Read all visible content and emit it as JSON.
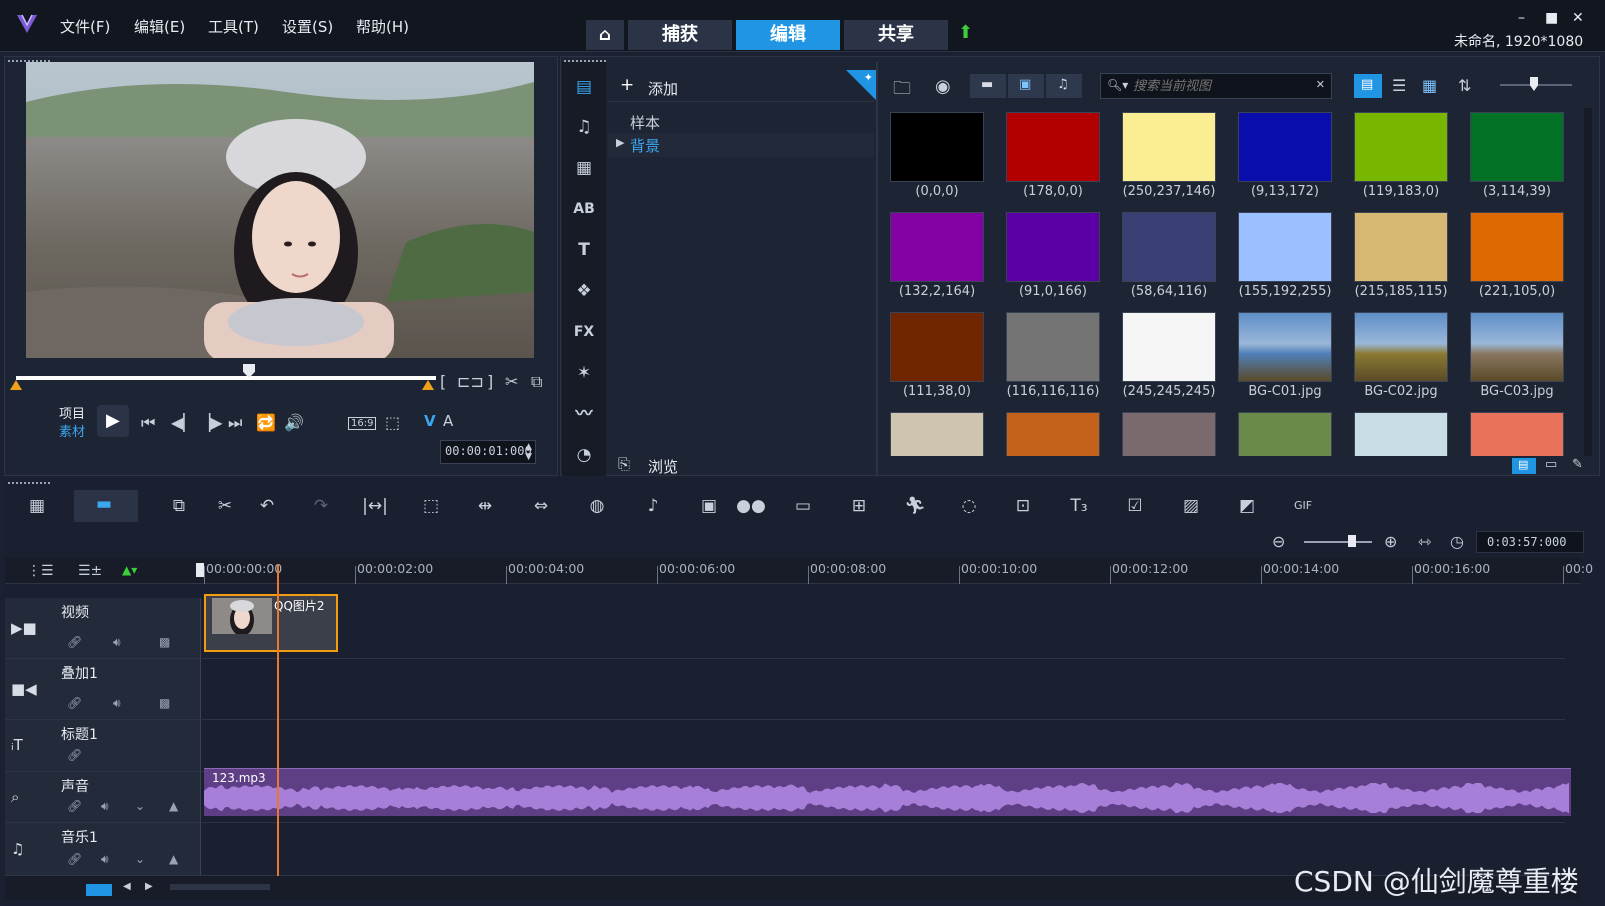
{
  "menu": [
    "文件(F)",
    "编辑(E)",
    "工具(T)",
    "设置(S)",
    "帮助(H)"
  ],
  "main_tabs": {
    "home_icon": "home-icon",
    "capture": "捕获",
    "edit": "编辑",
    "share": "共享"
  },
  "project_info": "未命名, 1920*1080",
  "window_controls": {
    "minimize": "–",
    "maximize": "■",
    "close": "✕"
  },
  "player": {
    "mode_project": "项目",
    "mode_clip": "素材",
    "timecode": "00:00:01:000",
    "aspect": "16:9",
    "v_label": "V",
    "a_label": "A"
  },
  "library": {
    "add_label": "添加",
    "tree": [
      "样本",
      "背景"
    ],
    "selected_tree_item": "背景",
    "browse_label": "浏览",
    "search_placeholder": "搜索当前视图",
    "side_icons": [
      "media-icon",
      "instant-project-icon",
      "transition-icon",
      "title-ab-icon",
      "text-icon",
      "graphic-icon",
      "fx-icon",
      "filter-icon",
      "path-icon",
      "speed-icon"
    ],
    "fx_label": "FX",
    "swatches": [
      {
        "label": "(0,0,0)",
        "color": "#000000"
      },
      {
        "label": "(178,0,0)",
        "color": "#b20000"
      },
      {
        "label": "(250,237,146)",
        "color": "#faed92"
      },
      {
        "label": "(9,13,172)",
        "color": "#090dac"
      },
      {
        "label": "(119,183,0)",
        "color": "#77b700"
      },
      {
        "label": "(3,114,39)",
        "color": "#037227"
      },
      {
        "label": "(132,2,164)",
        "color": "#8402a4"
      },
      {
        "label": "(91,0,166)",
        "color": "#5b00a6"
      },
      {
        "label": "(58,64,116)",
        "color": "#3a4074"
      },
      {
        "label": "(155,192,255)",
        "color": "#9bc0ff"
      },
      {
        "label": "(215,185,115)",
        "color": "#d7b973"
      },
      {
        "label": "(221,105,0)",
        "color": "#dd6900"
      },
      {
        "label": "(111,38,0)",
        "color": "#6f2600"
      },
      {
        "label": "(116,116,116)",
        "color": "#747474"
      },
      {
        "label": "(245,245,245)",
        "color": "#f5f5f5"
      },
      {
        "label": "BG-C01.jpg",
        "color": "#4f7fb8"
      },
      {
        "label": "BG-C02.jpg",
        "color": "#8a7a32"
      },
      {
        "label": "BG-C03.jpg",
        "color": "#8a7660"
      }
    ],
    "partial_swatches": [
      "#cfc4b0",
      "#c4621c",
      "#7a6a6e",
      "#6a8a4a",
      "#c8dce6",
      "#e8735a"
    ]
  },
  "timeline": {
    "ruler": [
      "00:00:00:00",
      "00:00:02:00",
      "00:00:04:00",
      "00:00:06:00",
      "00:00:08:00",
      "00:00:10:00",
      "00:00:12:00",
      "00:00:14:00",
      "00:00:16:00",
      "00:0"
    ],
    "duration": "0:03:57:000",
    "tracks": [
      {
        "name": "视频",
        "icon": "video-track-icon"
      },
      {
        "name": "叠加1",
        "icon": "overlay-track-icon"
      },
      {
        "name": "标题1",
        "icon": "title-track-icon"
      },
      {
        "name": "声音",
        "icon": "voice-track-icon"
      },
      {
        "name": "音乐1",
        "icon": "music-track-icon"
      }
    ],
    "video_clip_label": "QQ图片2",
    "audio_clip_label": "123.mp3"
  },
  "watermark": "CSDN @仙剑魔尊重楼",
  "colors": {
    "accent": "#1f95e4",
    "waveform": "#a77fd8",
    "audio_bg": "#5e3f86",
    "clip_border": "#f39c12",
    "playhead": "#e8792c"
  }
}
